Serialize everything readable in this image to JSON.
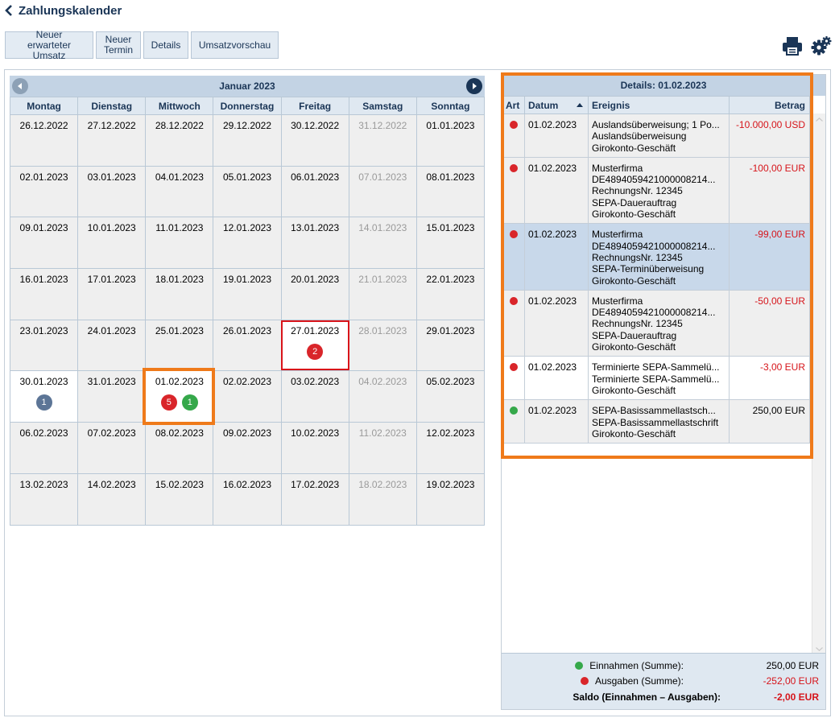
{
  "header": {
    "title": "Zahlungskalender"
  },
  "toolbar": {
    "buttons": [
      {
        "label": "Neuer erwarteter\nUmsatz"
      },
      {
        "label": "Neuer\nTermin"
      },
      {
        "label": "Details"
      },
      {
        "label": "Umsatzvorschau"
      }
    ]
  },
  "top_icons": [
    "printer-icon",
    "settings-gears-icon"
  ],
  "calendar": {
    "month": "Januar 2023",
    "weekdays": [
      "Montag",
      "Dienstag",
      "Mittwoch",
      "Donnerstag",
      "Freitag",
      "Samstag",
      "Sonntag"
    ],
    "weeks": [
      [
        "26.12.2022",
        "27.12.2022",
        "28.12.2022",
        "29.12.2022",
        "30.12.2022",
        "31.12.2022",
        "01.01.2023"
      ],
      [
        "02.01.2023",
        "03.01.2023",
        "04.01.2023",
        "05.01.2023",
        "06.01.2023",
        "07.01.2023",
        "08.01.2023"
      ],
      [
        "09.01.2023",
        "10.01.2023",
        "11.01.2023",
        "12.01.2023",
        "13.01.2023",
        "14.01.2023",
        "15.01.2023"
      ],
      [
        "16.01.2023",
        "17.01.2023",
        "18.01.2023",
        "19.01.2023",
        "20.01.2023",
        "21.01.2023",
        "22.01.2023"
      ],
      [
        "23.01.2023",
        "24.01.2023",
        "25.01.2023",
        "26.01.2023",
        "27.01.2023",
        "28.01.2023",
        "29.01.2023"
      ],
      [
        "30.01.2023",
        "31.01.2023",
        "01.02.2023",
        "02.02.2023",
        "03.02.2023",
        "04.02.2023",
        "05.02.2023"
      ],
      [
        "06.02.2023",
        "07.02.2023",
        "08.02.2023",
        "09.02.2023",
        "10.02.2023",
        "11.02.2023",
        "12.02.2023"
      ],
      [
        "13.02.2023",
        "14.02.2023",
        "15.02.2023",
        "16.02.2023",
        "17.02.2023",
        "18.02.2023",
        "19.02.2023"
      ]
    ],
    "badges": {
      "27.01.2023": [
        {
          "count": "2",
          "color": "red"
        }
      ],
      "30.01.2023": [
        {
          "count": "1",
          "color": "blue"
        }
      ],
      "01.02.2023": [
        {
          "count": "5",
          "color": "red"
        },
        {
          "count": "1",
          "color": "green"
        }
      ]
    },
    "selected_date": "01.02.2023",
    "marked_date": "27.01.2023"
  },
  "details": {
    "title": "Details: 01.02.2023",
    "columns": {
      "art": "Art",
      "datum": "Datum",
      "ereignis": "Ereignis",
      "betrag": "Betrag"
    },
    "rows": [
      {
        "type": "red",
        "date": "01.02.2023",
        "lines": [
          "Auslandsüberweisung; 1 Po...",
          "Auslandsüberweisung",
          "Girokonto-Geschäft"
        ],
        "amount": "-10.000,00 USD",
        "negative": true,
        "selected": false
      },
      {
        "type": "red",
        "date": "01.02.2023",
        "lines": [
          "Musterfirma",
          "DE4894059421000008214...",
          "RechnungsNr. 12345",
          "SEPA-Dauerauftrag",
          "Girokonto-Geschäft"
        ],
        "amount": "-100,00 EUR",
        "negative": true,
        "selected": false
      },
      {
        "type": "red",
        "date": "01.02.2023",
        "lines": [
          "Musterfirma",
          "DE4894059421000008214...",
          "RechnungsNr. 12345",
          "SEPA-Terminüberweisung",
          "Girokonto-Geschäft"
        ],
        "amount": "-99,00 EUR",
        "negative": true,
        "selected": true
      },
      {
        "type": "red",
        "date": "01.02.2023",
        "lines": [
          "Musterfirma",
          "DE4894059421000008214...",
          "RechnungsNr. 12345",
          "SEPA-Dauerauftrag",
          "Girokonto-Geschäft"
        ],
        "amount": "-50,00 EUR",
        "negative": true,
        "selected": false
      },
      {
        "type": "red",
        "date": "01.02.2023",
        "lines": [
          "Terminierte SEPA-Sammelü...",
          "Terminierte SEPA-Sammelü...",
          "Girokonto-Geschäft"
        ],
        "amount": "-3,00 EUR",
        "negative": true,
        "selected": false
      },
      {
        "type": "green",
        "date": "01.02.2023",
        "lines": [
          "SEPA-Basissammellastsch...",
          "SEPA-Basissammellastschrift",
          "Girokonto-Geschäft"
        ],
        "amount": "250,00 EUR",
        "negative": false,
        "selected": false
      }
    ],
    "summary": {
      "income_label": "Einnahmen (Summe):",
      "income_value": "250,00 EUR",
      "expense_label": "Ausgaben (Summe):",
      "expense_value": "-252,00 EUR",
      "balance_label": "Saldo (Einnahmen – Ausgaben):",
      "balance_value": "-2,00 EUR"
    }
  },
  "colors": {
    "accent_navy": "#1a3556",
    "header_blue": "#c3d3e4",
    "highlight_orange": "#ef7a1a",
    "expense_red": "#d9252a",
    "income_green": "#35a84a"
  }
}
